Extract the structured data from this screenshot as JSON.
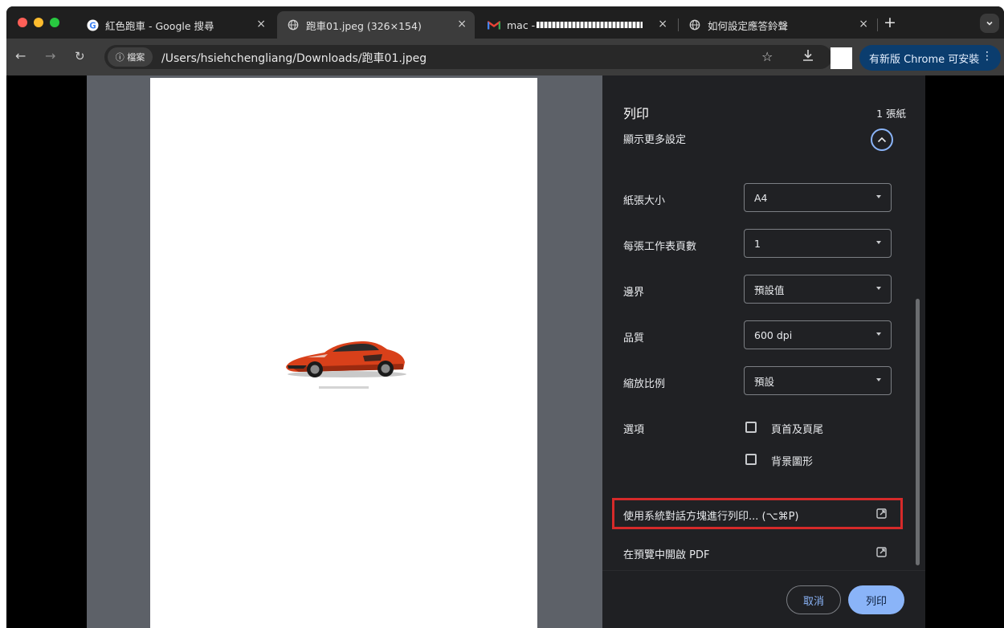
{
  "tabs": [
    {
      "favicon": "google-g-icon",
      "title": "紅色跑車 - Google 搜尋",
      "close": "×"
    },
    {
      "favicon": "globe-icon",
      "title": "跑車01.jpeg (326×154)",
      "close": "×"
    },
    {
      "favicon": "gmail-m-icon",
      "title": "mac - ",
      "close": "×"
    },
    {
      "favicon": "globe-icon",
      "title": "如何設定應答鈴聲",
      "close": "×"
    }
  ],
  "new_tab": "+",
  "toolbar": {
    "site_info_label": "ⓘ 檔案",
    "url": "/Users/hsiehchengliang/Downloads/跑車01.jpeg",
    "update_label": "有新版 Chrome 可安裝",
    "menu": "⋮"
  },
  "print": {
    "title": "列印",
    "sheets": "1 張紙",
    "more_settings": "顯示更多設定",
    "settings": [
      {
        "label": "紙張大小",
        "value": "A4"
      },
      {
        "label": "每張工作表頁數",
        "value": "1"
      },
      {
        "label": "邊界",
        "value": "預設值"
      },
      {
        "label": "品質",
        "value": "600 dpi"
      },
      {
        "label": "縮放比例",
        "value": "預設"
      }
    ],
    "options_label": "選項",
    "options": [
      {
        "label": "頁首及頁尾",
        "checked": false
      },
      {
        "label": "背景圖形",
        "checked": false
      }
    ],
    "system_dialog": "使用系統對話方塊進行列印... (⌥⌘P)",
    "open_pdf": "在預覽中開啟 PDF",
    "cancel": "取消",
    "print": "列印"
  },
  "colors": {
    "accent": "#8ab4f8",
    "highlight": "#d62a2a",
    "car_body": "#d8401a"
  }
}
